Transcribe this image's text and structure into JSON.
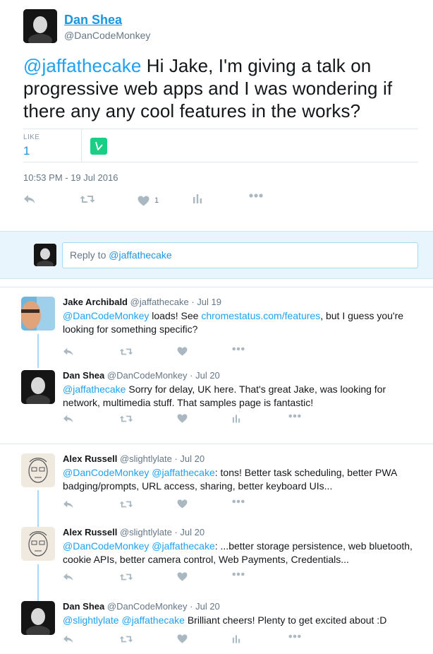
{
  "main_tweet": {
    "author_name": "Dan Shea",
    "author_handle": "@DanCodeMonkey",
    "mention": "@jaffathecake",
    "text": " Hi Jake, I'm giving a talk on progressive web apps and I was wondering if there any any cool features in the works?",
    "like_label": "LIKE",
    "like_count": "1",
    "timestamp": "10:53 PM - 19 Jul 2016",
    "action_like_count": "1"
  },
  "reply_box": {
    "prefix": "Reply to ",
    "to": "@jaffathecake"
  },
  "conversation": [
    {
      "tweets": [
        {
          "name": "Jake Archibald",
          "handle": "@jaffathecake",
          "date": "Jul 19",
          "segments": [
            {
              "text": "@DanCodeMonkey",
              "link": true
            },
            {
              "text": " loads! See ",
              "link": false
            },
            {
              "text": "chromestatus.com/features",
              "link": true
            },
            {
              "text": ", but I guess you're looking for something specific?",
              "link": false
            }
          ]
        },
        {
          "name": "Dan Shea",
          "handle": "@DanCodeMonkey",
          "date": "Jul 20",
          "segments": [
            {
              "text": "@jaffathecake",
              "link": true
            },
            {
              "text": " Sorry for delay, UK here. That's great Jake, was looking for network, multimedia stuff. That samples page is fantastic!",
              "link": false
            }
          ]
        }
      ]
    },
    {
      "tweets": [
        {
          "name": "Alex Russell",
          "handle": "@slightlylate",
          "date": "Jul 20",
          "segments": [
            {
              "text": "@DanCodeMonkey",
              "link": true
            },
            {
              "text": " ",
              "link": false
            },
            {
              "text": "@jaffathecake",
              "link": true
            },
            {
              "text": ": tons! Better task scheduling, better PWA badging/prompts, URL access, sharing, better keyboard UIs...",
              "link": false
            }
          ]
        },
        {
          "name": "Alex Russell",
          "handle": "@slightlylate",
          "date": "Jul 20",
          "segments": [
            {
              "text": "@DanCodeMonkey",
              "link": true
            },
            {
              "text": " ",
              "link": false
            },
            {
              "text": "@jaffathecake",
              "link": true
            },
            {
              "text": ": ...better storage persistence, web bluetooth, cookie APIs, better camera control, Web Payments, Credentials...",
              "link": false
            }
          ]
        },
        {
          "name": "Dan Shea",
          "handle": "@DanCodeMonkey",
          "date": "Jul 20",
          "segments": [
            {
              "text": "@slightlylate",
              "link": true
            },
            {
              "text": " ",
              "link": false
            },
            {
              "text": "@jaffathecake",
              "link": true
            },
            {
              "text": " Brilliant cheers! Plenty to get excited about :D",
              "link": false
            }
          ]
        }
      ]
    }
  ],
  "separator": " · ",
  "icons": [
    "reply-icon",
    "retweet-icon",
    "heart-icon",
    "analytics-icon",
    "more-icon",
    "vine-logo-icon"
  ],
  "colors": {
    "link": "#1b95e0",
    "icon": "#aab8c2",
    "thread": "#a4d9f9",
    "reply_bg": "#e8f5fd",
    "vine": "#19cf86"
  }
}
